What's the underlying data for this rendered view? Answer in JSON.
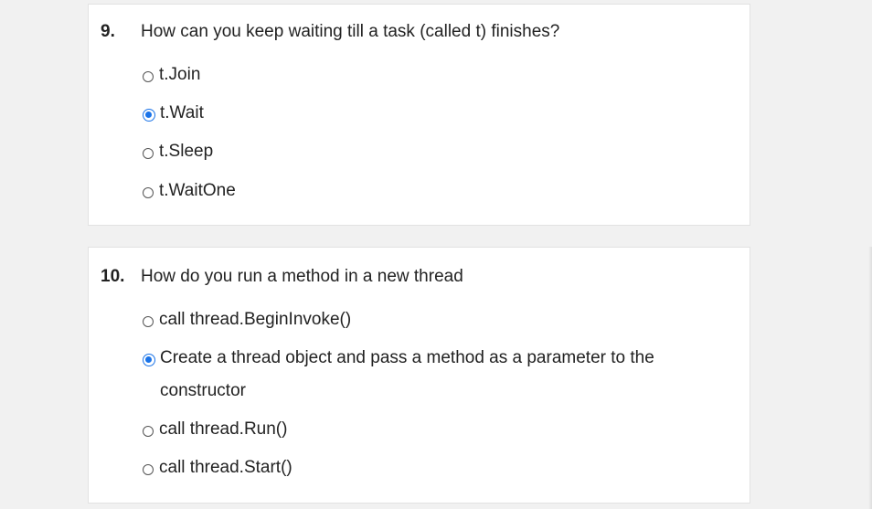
{
  "questions": [
    {
      "number": "9.",
      "text": "How can you keep waiting till a task (called t) finishes?",
      "options": [
        {
          "label": "t.Join",
          "selected": false
        },
        {
          "label": "t.Wait",
          "selected": true
        },
        {
          "label": "t.Sleep",
          "selected": false
        },
        {
          "label": "t.WaitOne",
          "selected": false
        }
      ]
    },
    {
      "number": "10.",
      "text": "How do you run a method in a new thread",
      "options": [
        {
          "label": "call thread.BeginInvoke()",
          "selected": false
        },
        {
          "label": "Create a thread object and pass a method as a parameter to the constructor",
          "selected": true
        },
        {
          "label": "call thread.Run()",
          "selected": false
        },
        {
          "label": "call thread.Start()",
          "selected": false
        }
      ]
    }
  ],
  "colors": {
    "selected_radio": "#1a73e8",
    "background": "#f1f1f1",
    "card": "#ffffff"
  }
}
